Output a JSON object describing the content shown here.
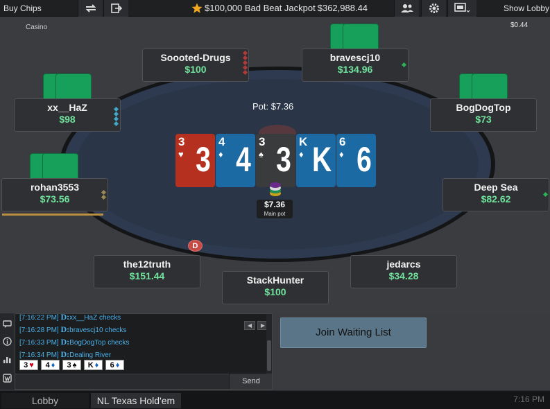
{
  "topbar": {
    "buy_chips": "Buy Chips",
    "jackpot_label": "$100,000 Bad Beat Jackpot",
    "jackpot_value": "$362,988.44",
    "show_lobby": "Show Lobby",
    "icons": [
      "swap-tables-icon",
      "leave-table-icon",
      "players-icon",
      "gear-icon",
      "layout-icon"
    ]
  },
  "table": {
    "casino_label": "Casino",
    "balance": "$0.44",
    "pot_label": "Pot: $7.36",
    "main_pot_amount": "$7.36",
    "main_pot_label": "Main pot",
    "dealer_button": "D"
  },
  "board": [
    {
      "rank": "3",
      "suit": "♥",
      "color": "#b5301f"
    },
    {
      "rank": "4",
      "suit": "♦",
      "color": "#1b6aa3"
    },
    {
      "rank": "3",
      "suit": "♠",
      "color": "#3a3b3d"
    },
    {
      "rank": "K",
      "suit": "♦",
      "color": "#1b6aa3"
    },
    {
      "rank": "6",
      "suit": "♦",
      "color": "#1b6aa3"
    }
  ],
  "seats": [
    {
      "name": "Soooted-Drugs",
      "stack": "$100"
    },
    {
      "name": "bravescj10",
      "stack": "$134.96"
    },
    {
      "name": "xx__HaZ",
      "stack": "$98"
    },
    {
      "name": "BogDogTop",
      "stack": "$73"
    },
    {
      "name": "rohan3553",
      "stack": "$73.56"
    },
    {
      "name": "Deep Sea",
      "stack": "$82.62"
    },
    {
      "name": "the12truth",
      "stack": "$151.44"
    },
    {
      "name": "jedarcs",
      "stack": "$34.28"
    },
    {
      "name": "StackHunter",
      "stack": "$100"
    }
  ],
  "chat": {
    "lines": [
      {
        "time": "[7:16:22 PM]",
        "text": "xx__HaZ  checks"
      },
      {
        "time": "[7:16:28 PM]",
        "text": "bravescj10  checks"
      },
      {
        "time": "[7:16:33 PM]",
        "text": "BogDogTop  checks"
      },
      {
        "time": "[7:16:34 PM]",
        "text": "Dealing River"
      }
    ],
    "board_summary": [
      {
        "rank": "3",
        "suit": "♥",
        "color": "#d0021b"
      },
      {
        "rank": "4",
        "suit": "♦",
        "color": "#1565c0"
      },
      {
        "rank": "3",
        "suit": "♠",
        "color": "#000000"
      },
      {
        "rank": "K",
        "suit": "♦",
        "color": "#1565c0"
      },
      {
        "rank": "6",
        "suit": "♦",
        "color": "#1565c0"
      }
    ],
    "send_label": "Send",
    "input_value": ""
  },
  "actions": {
    "join_waiting_list": "Join Waiting List"
  },
  "statusbar": {
    "lobby_tab": "Lobby",
    "game_tab": "NL Texas Hold'em",
    "clock": "7:16 PM"
  }
}
